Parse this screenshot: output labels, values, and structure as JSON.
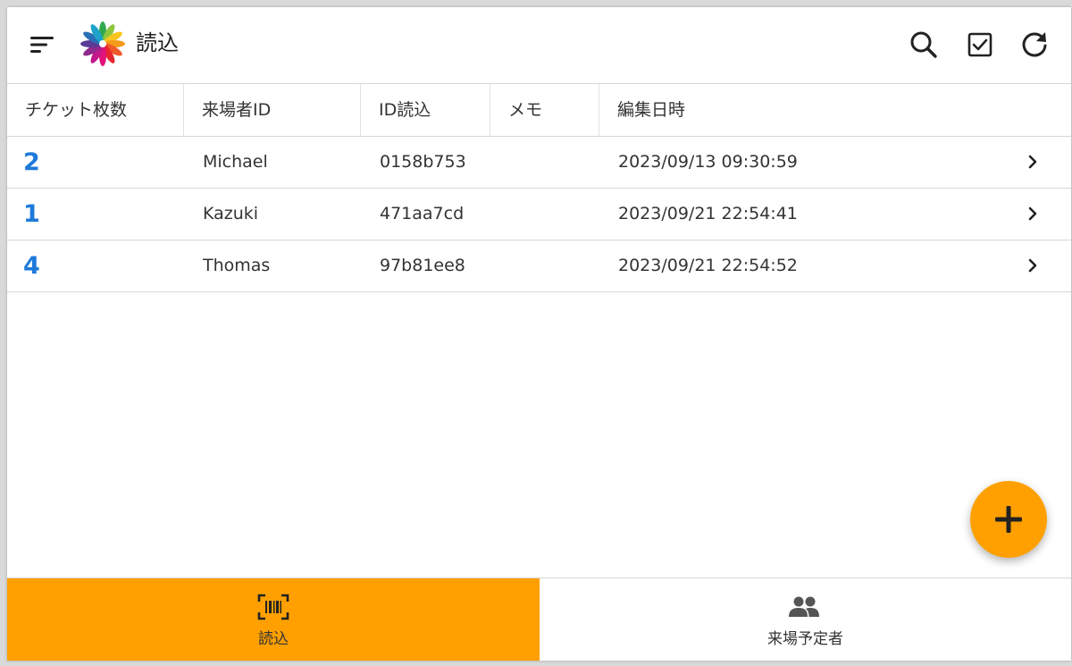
{
  "app": {
    "title": "読込"
  },
  "toolbar": {
    "menu_icon": "sort-menu-icon",
    "logo_icon": "flower-logo",
    "actions": [
      "search-icon",
      "check-box-icon",
      "refresh-icon"
    ]
  },
  "table": {
    "columns": [
      "チケット枚数",
      "来場者ID",
      "ID読込",
      "メモ",
      "編集日時"
    ],
    "rows": [
      {
        "tickets": "2",
        "visitor_id": "Michael",
        "id_read": "0158b753",
        "memo": "",
        "edited": "2023/09/13 09:30:59"
      },
      {
        "tickets": "1",
        "visitor_id": "Kazuki",
        "id_read": "471aa7cd",
        "memo": "",
        "edited": "2023/09/21 22:54:41"
      },
      {
        "tickets": "4",
        "visitor_id": "Thomas",
        "id_read": "97b81ee8",
        "memo": "",
        "edited": "2023/09/21 22:54:52"
      }
    ]
  },
  "fab": {
    "icon": "add-icon"
  },
  "bottom_nav": {
    "items": [
      {
        "label": "読込",
        "icon": "barcode-scan-icon",
        "active": true
      },
      {
        "label": "来場予定者",
        "icon": "people-icon",
        "active": false
      }
    ]
  },
  "colors": {
    "accent": "#ffa000",
    "count_text": "#1e7ad9",
    "divider": "#d6d6d6"
  }
}
